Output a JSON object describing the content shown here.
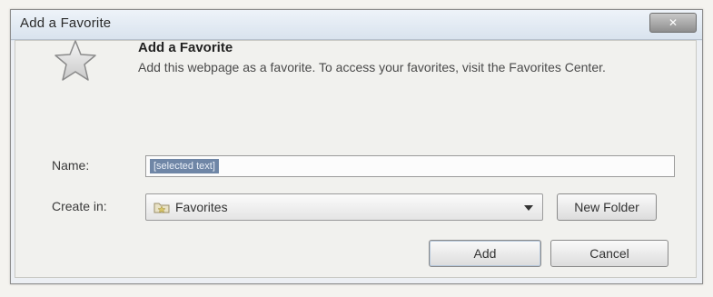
{
  "window": {
    "title": "Add a Favorite",
    "close_label": "Close"
  },
  "header": {
    "heading": "Add a Favorite",
    "description": "Add this webpage as a favorite. To access your favorites, visit the Favorites Center."
  },
  "form": {
    "name_label": "Name:",
    "name_value": "[selected text]",
    "create_in_label": "Create in:",
    "create_in_value": "Favorites"
  },
  "buttons": {
    "new_folder": "New Folder",
    "add": "Add",
    "cancel": "Cancel"
  },
  "icons": {
    "star": "star-icon",
    "folder": "folder-icon",
    "dropdown": "chevron-down-icon"
  }
}
